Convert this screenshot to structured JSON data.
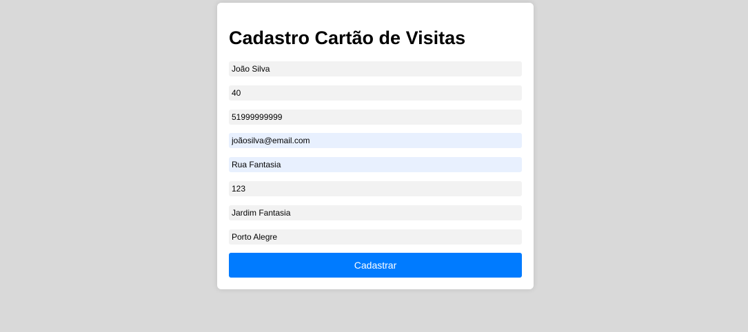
{
  "form": {
    "title": "Cadastro Cartão de Visitas",
    "fields": [
      {
        "name": "nome",
        "value": "João Silva"
      },
      {
        "name": "idade",
        "value": "40"
      },
      {
        "name": "telefone",
        "value": "51999999999"
      },
      {
        "name": "email",
        "value": "joãosilva@email.com"
      },
      {
        "name": "rua",
        "value": "Rua Fantasia"
      },
      {
        "name": "numero",
        "value": "123"
      },
      {
        "name": "bairro",
        "value": "Jardim Fantasia"
      },
      {
        "name": "cidade",
        "value": "Porto Alegre"
      }
    ],
    "submit_label": "Cadastrar"
  },
  "colors": {
    "background": "#d9d9d9",
    "card": "#ffffff",
    "input": "#f2f2f2",
    "input_autofill": "#e8f0fe",
    "accent": "#007bff"
  }
}
